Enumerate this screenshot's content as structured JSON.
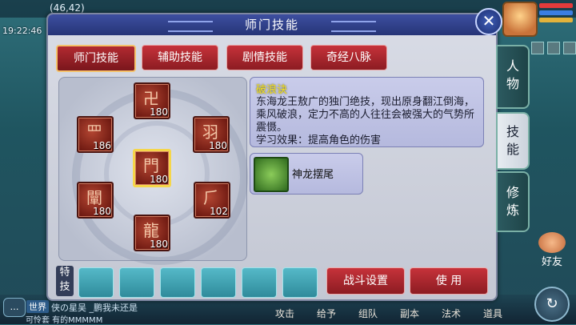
{
  "hud": {
    "coordinates": "(46,42)",
    "clock": "19:22:46",
    "friends_label": "好友",
    "chat_icon_label": "…",
    "chat_channel": "世界",
    "chat_line1": "   侠の星吴 _鹏我未还是",
    "chat_line2": "可怜套  有的MMMMM",
    "bottom_menu": [
      "攻击",
      "给予",
      "组队",
      "副本",
      "法术",
      "道具"
    ],
    "refresh_icon": "↻"
  },
  "panel": {
    "title": "师门技能",
    "close_label": "✕",
    "tabs": [
      "师门技能",
      "辅助技能",
      "剧情技能",
      "奇经八脉"
    ],
    "active_tab": 0,
    "side_tabs": [
      {
        "label_top": "人",
        "label_bottom": "物"
      },
      {
        "label_top": "技",
        "label_bottom": "能"
      },
      {
        "label_top": "修",
        "label_bottom": "炼"
      }
    ],
    "active_side_tab": 1
  },
  "skills": [
    {
      "glyph": "卍",
      "level": "180"
    },
    {
      "glyph": "罒",
      "level": "186"
    },
    {
      "glyph": "羽",
      "level": "180"
    },
    {
      "glyph": "門",
      "level": "180"
    },
    {
      "glyph": "闡",
      "level": "180"
    },
    {
      "glyph": "⺁",
      "level": "102"
    },
    {
      "glyph": "龍",
      "level": "180"
    }
  ],
  "selected_skill": 3,
  "info": {
    "name": "破浪诀",
    "description": "东海龙王敖广的独门绝技，现出原身翻江倒海，乘风破浪，定力不高的人往往会被强大的气势所震慑。",
    "effect": "学习效果：提高角色的伤害"
  },
  "sub_skill": {
    "name": "神龙摆尾"
  },
  "bottom": {
    "special_label": "特技",
    "slot_count": 6,
    "battle_settings": "战斗设置",
    "use": "使 用"
  },
  "colors": {
    "tab_red": "#c6323a",
    "title_blue": "#263477",
    "selected_border": "#f5d64a",
    "slot_teal": "#55b9c8",
    "skill_name_yellow": "#f4e022"
  }
}
